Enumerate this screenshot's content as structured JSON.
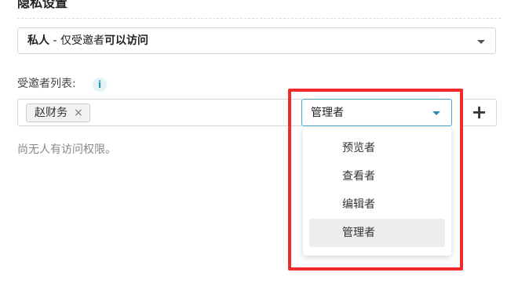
{
  "section": {
    "title": "隐私设置"
  },
  "privacy_select": {
    "value_bold": "私人",
    "value_normal": " - 仅受邀者",
    "value_bold_2": "可以访问"
  },
  "invitees": {
    "label": "受邀者列表:",
    "info_icon_text": "i",
    "chips": [
      {
        "name": "赵财务",
        "remove_glyph": "×"
      }
    ],
    "empty_note": "尚无人有访问权限。"
  },
  "role_select": {
    "value": "管理者",
    "options": [
      "预览者",
      "查看者",
      "编辑者",
      "管理者"
    ],
    "selected_index": 3
  },
  "add_button": {
    "label": "+"
  },
  "colors": {
    "accent": "#2a8fb0",
    "highlight": "#ee2a2a",
    "selected_bg": "#ebedef"
  }
}
